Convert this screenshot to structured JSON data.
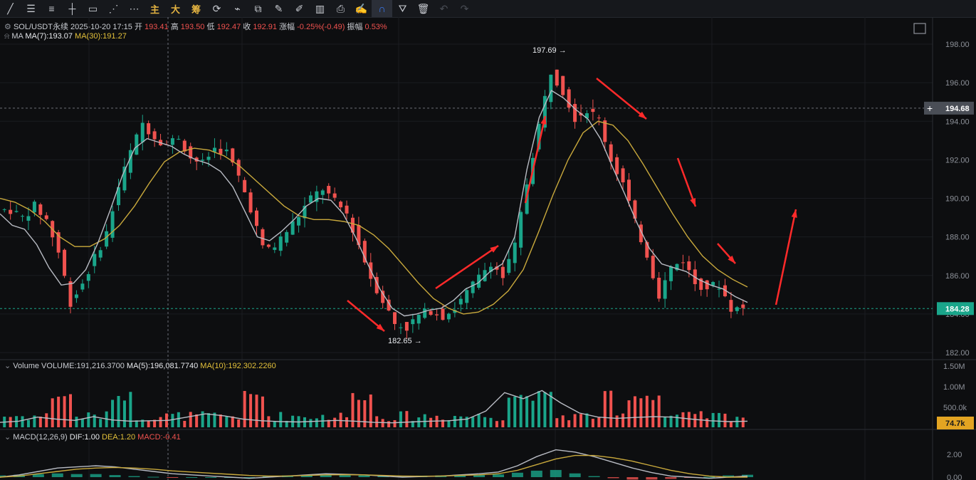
{
  "toolbar": {
    "items": [
      {
        "icon": "╱",
        "name": "line-tool-icon"
      },
      {
        "icon": "☰",
        "name": "hline-tool-icon"
      },
      {
        "icon": "≡",
        "name": "channel-tool-icon"
      },
      {
        "icon": "┼",
        "name": "crosshair-tool-icon"
      },
      {
        "icon": "▭",
        "name": "rect-tool-icon"
      },
      {
        "icon": "⋰",
        "name": "fib-tool-icon"
      },
      {
        "icon": "⋯",
        "name": "more-tools-icon"
      },
      {
        "icon": "主",
        "name": "main-indicator-button"
      },
      {
        "icon": "大",
        "name": "big-trade-button"
      },
      {
        "icon": "筹",
        "name": "chip-button"
      },
      {
        "icon": "⟳",
        "name": "replay-icon"
      },
      {
        "icon": "⌁",
        "name": "brush-icon"
      },
      {
        "icon": "⧉",
        "name": "select-icon"
      },
      {
        "icon": "✎",
        "name": "ruler-icon"
      },
      {
        "icon": "✐",
        "name": "pen-icon"
      },
      {
        "icon": "▥",
        "name": "indicator-icon"
      },
      {
        "icon": "⎙",
        "name": "lock-icon"
      },
      {
        "icon": "✍",
        "name": "note-icon"
      },
      {
        "icon": "∩",
        "name": "magnet-icon"
      },
      {
        "icon": "⛛",
        "name": "filter-icon"
      },
      {
        "icon": "🗑",
        "name": "trash-icon"
      },
      {
        "icon": "↶",
        "name": "undo-icon"
      },
      {
        "icon": "↷",
        "name": "redo-icon"
      }
    ]
  },
  "header": {
    "symbol": "SOL/USDT永续",
    "datetime": "2025-10-20 17:15",
    "open_label": "开",
    "open": "193.41",
    "high_label": "高",
    "high": "193.50",
    "low_label": "低",
    "low": "192.47",
    "close_label": "收",
    "close": "192.91",
    "change_label": "涨幅",
    "change": "-0.25%(-0.49)",
    "amp_label": "振幅",
    "amp": "0.53%"
  },
  "ma_row": {
    "label": "MA",
    "ma7": "MA(7):193.07",
    "ma30": "MA(30):191.27"
  },
  "volume_row": {
    "label": "Volume",
    "vol": "VOLUME:191,216.3700",
    "ma5": "MA(5):196,081.7740",
    "ma10": "MA(10):192,302.2260"
  },
  "macd_row": {
    "label": "MACD(12,26,9)",
    "dif": "DIF:1.00",
    "dea": "DEA:1.20",
    "macd": "MACD:-0.41"
  },
  "price_axis": {
    "ticks": [
      "198.00",
      "196.00",
      "194.00",
      "192.00",
      "190.00",
      "188.00",
      "186.00",
      "184.00",
      "182.00"
    ]
  },
  "vol_axis": {
    "ticks": [
      "1.50M",
      "1.00M",
      "500.0k"
    ]
  },
  "macd_axis": {
    "ticks": [
      "2.00",
      "0.00"
    ]
  },
  "markers": {
    "high": "197.69",
    "low": "182.65",
    "crosshair_price": "194.68",
    "last_price": "184.28",
    "last_volume": "74.7k"
  },
  "colors": {
    "up": "#1aa58a",
    "down": "#f0524f",
    "ma7": "#b9bcc4",
    "ma30": "#c9a93c",
    "arrow": "#ff2a2a",
    "bg": "#0d0e10"
  },
  "chart_data": {
    "type": "candlestick",
    "price_ylim": [
      181.5,
      198.5
    ],
    "volume_ylim": [
      0,
      1500000
    ],
    "macd_ylim": [
      -0.2,
      2.4
    ],
    "close_path": [
      189.4,
      189.0,
      189.6,
      188.9,
      187.2,
      184.6,
      185.6,
      186.9,
      188.2,
      190.6,
      192.4,
      193.9,
      193.2,
      192.8,
      193.2,
      192.1,
      191.8,
      192.6,
      192.4,
      191.1,
      189.5,
      187.4,
      187.5,
      188.3,
      189.1,
      190.0,
      190.5,
      189.8,
      189.2,
      187.6,
      185.9,
      184.7,
      183.5,
      183.3,
      183.9,
      184.2,
      183.9,
      184.3,
      185.1,
      185.9,
      186.7,
      185.9,
      187.5,
      190.8,
      193.8,
      196.6,
      195.6,
      194.2,
      194.6,
      194.1,
      192.0,
      190.8,
      188.7,
      187.1,
      185.0,
      186.4,
      186.8,
      185.6,
      185.4,
      185.5,
      184.3,
      184.28
    ],
    "ma7_path": [
      189.2,
      188.6,
      188.4,
      187.6,
      186.4,
      185.5,
      185.6,
      186.3,
      187.7,
      189.4,
      191.2,
      192.6,
      193.1,
      192.9,
      192.7,
      192.3,
      192.0,
      191.8,
      191.4,
      190.6,
      189.3,
      188.0,
      187.8,
      188.3,
      188.9,
      189.6,
      190.0,
      189.9,
      189.2,
      188.0,
      186.6,
      185.3,
      184.3,
      183.9,
      184.0,
      184.2,
      184.3,
      184.7,
      185.3,
      185.6,
      186.2,
      186.6,
      188.0,
      191.5,
      194.2,
      195.6,
      195.2,
      194.6,
      194.1,
      193.1,
      191.6,
      190.2,
      188.7,
      187.4,
      186.6,
      186.4,
      186.2,
      185.8,
      185.5,
      185.3,
      184.9,
      184.6
    ],
    "ma30_path": [
      190.0,
      189.8,
      189.4,
      188.8,
      188.0,
      187.5,
      187.5,
      187.9,
      188.6,
      189.6,
      190.8,
      191.9,
      192.4,
      192.6,
      192.5,
      192.2,
      191.7,
      191.0,
      190.3,
      189.6,
      189.1,
      188.9,
      188.9,
      188.8,
      188.6,
      188.1,
      187.4,
      186.5,
      185.6,
      184.8,
      184.3,
      184.0,
      184.1,
      184.5,
      185.2,
      186.3,
      188.2,
      190.2,
      192.0,
      193.4,
      194.0,
      193.8,
      193.0,
      191.8,
      190.5,
      189.2,
      188.0,
      187.0,
      186.3,
      185.8,
      185.4
    ],
    "ma30_start_index": 0,
    "annotated_high": 197.69,
    "annotated_low": 182.65,
    "last_price": 184.28,
    "crosshair_price": 194.68,
    "macd_dif_path": [
      0.0,
      0.2,
      0.5,
      0.8,
      0.9,
      1.0,
      0.9,
      0.7,
      0.5,
      0.3,
      0.2,
      0.1,
      0.0,
      -0.1,
      0.0,
      0.1,
      0.2,
      0.3,
      0.25,
      0.2,
      0.1,
      0.0,
      0.05,
      0.1,
      0.2,
      0.3,
      0.45,
      1.0,
      1.8,
      2.4,
      2.2,
      1.8,
      1.3,
      0.8,
      0.4,
      0.1,
      0.0,
      -0.1,
      0.0,
      0.1
    ],
    "macd_dea_path": [
      0.0,
      0.1,
      0.3,
      0.5,
      0.7,
      0.8,
      0.85,
      0.8,
      0.7,
      0.55,
      0.45,
      0.35,
      0.25,
      0.15,
      0.1,
      0.1,
      0.15,
      0.2,
      0.22,
      0.2,
      0.15,
      0.1,
      0.08,
      0.1,
      0.15,
      0.2,
      0.3,
      0.6,
      1.1,
      1.6,
      1.9,
      1.9,
      1.7,
      1.4,
      1.0,
      0.6,
      0.3,
      0.1,
      0.0,
      0.0
    ],
    "volume_ma5_path": [
      120000,
      150000,
      250000,
      200000,
      170000,
      260000,
      180000,
      150000,
      160000,
      170000,
      250000,
      330000,
      280000,
      200000,
      160000,
      140000,
      130000,
      150000,
      170000,
      150000,
      120000,
      110000,
      130000,
      150000,
      160000,
      200000,
      400000,
      850000,
      700000,
      900000,
      600000,
      350000,
      250000,
      220000,
      240000,
      260000,
      250000,
      200000,
      160000,
      140000,
      150000
    ]
  }
}
